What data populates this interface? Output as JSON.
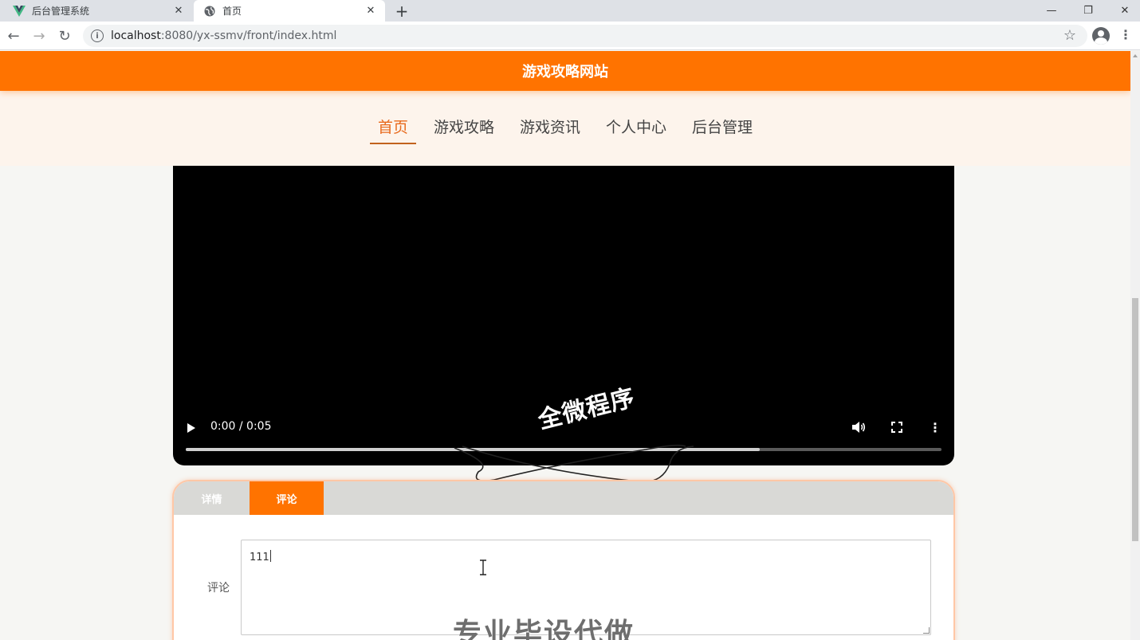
{
  "browser": {
    "tabs": [
      {
        "title": "后台管理系统",
        "favicon": "vue-logo-icon",
        "active": false
      },
      {
        "title": "首页",
        "favicon": "globe-icon",
        "active": true
      }
    ],
    "url_host": "localhost",
    "url_path": ":8080/yx-ssmv/front/index.html",
    "window_controls": [
      "minimize-icon",
      "restore-icon",
      "close-icon"
    ]
  },
  "site": {
    "title": "游戏攻略网站",
    "nav": [
      {
        "label": "首页",
        "active": true
      },
      {
        "label": "游戏攻略",
        "active": false
      },
      {
        "label": "游戏资讯",
        "active": false
      },
      {
        "label": "个人中心",
        "active": false
      },
      {
        "label": "后台管理",
        "active": false
      }
    ],
    "accent_color": "#ff7300"
  },
  "video": {
    "time": "0:00 / 0:05",
    "progress_fraction": 0.76,
    "watermark": "全微程序"
  },
  "detail_tabs": {
    "items": [
      {
        "label": "详情",
        "active": false
      },
      {
        "label": "评论",
        "active": true
      }
    ]
  },
  "comment_form": {
    "label": "评论",
    "value": "111",
    "watermark": "专业毕设代做"
  }
}
